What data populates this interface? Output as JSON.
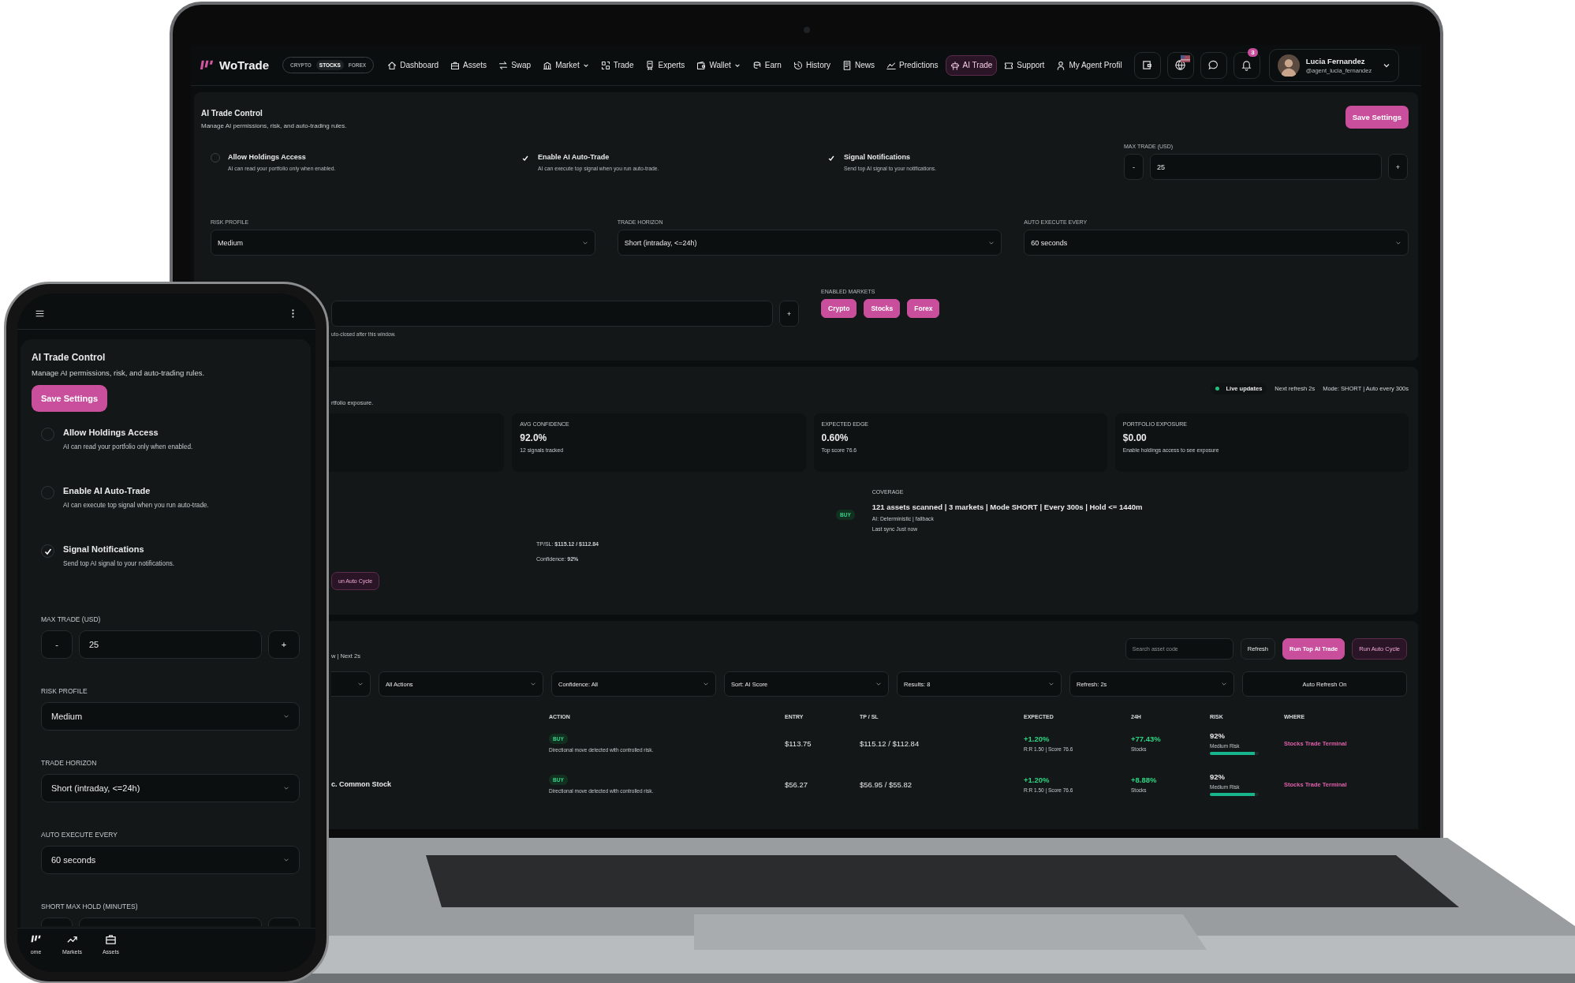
{
  "laptop": {
    "nav": {
      "brand": "WoTrade",
      "market_switch": [
        {
          "label": "CRYPTO",
          "selected": false
        },
        {
          "label": "STOCKS",
          "selected": true
        },
        {
          "label": "FOREX",
          "selected": false
        }
      ],
      "items": [
        {
          "label": "Dashboard",
          "dropdown": false,
          "selected": false
        },
        {
          "label": "Assets",
          "dropdown": false,
          "selected": false
        },
        {
          "label": "Swap",
          "dropdown": false,
          "selected": false
        },
        {
          "label": "Market",
          "dropdown": true,
          "selected": false
        },
        {
          "label": "Trade",
          "dropdown": false,
          "selected": false
        },
        {
          "label": "Experts",
          "dropdown": false,
          "selected": false
        },
        {
          "label": "Wallet",
          "dropdown": true,
          "selected": false
        },
        {
          "label": "Earn",
          "dropdown": false,
          "selected": false
        },
        {
          "label": "History",
          "dropdown": false,
          "selected": false
        },
        {
          "label": "News",
          "dropdown": false,
          "selected": false
        },
        {
          "label": "Predictions",
          "dropdown": false,
          "selected": false
        },
        {
          "label": "AI Trade",
          "dropdown": false,
          "selected": true
        },
        {
          "label": "Support",
          "dropdown": false,
          "selected": false
        },
        {
          "label": "My Agent Profil",
          "dropdown": false,
          "selected": false
        }
      ],
      "notification_count": "3",
      "user": {
        "name": "Lucia Fernandez",
        "handle": "@agent_lucia_fernandez"
      }
    },
    "settings": {
      "title": "AI Trade Control",
      "subtitle": "Manage AI permissions, risk, and auto-trading rules.",
      "save_button": "Save Settings",
      "toggles": [
        {
          "title": "Allow Holdings Access",
          "description": "AI can read your portfolio only when enabled.",
          "checked": false
        },
        {
          "title": "Enable AI Auto-Trade",
          "description": "AI can execute top signal when you run auto-trade.",
          "checked": true
        },
        {
          "title": "Signal Notifications",
          "description": "Send top AI signal to your notifications.",
          "checked": true
        }
      ],
      "max_trade": {
        "label": "MAX TRADE (USD)",
        "minus": "-",
        "value": "25",
        "plus": "+"
      },
      "selects": [
        {
          "label": "RISK PROFILE",
          "value": "Medium"
        },
        {
          "label": "TRADE HORIZON",
          "value": "Short (intraday, <=24h)"
        },
        {
          "label": "AUTO EXECUTE EVERY",
          "value": "60 seconds"
        }
      ],
      "hold_field": {
        "plus": "+",
        "hint": "uto-closed after this window."
      },
      "markets": {
        "label": "ENABLED MARKETS",
        "chips": [
          {
            "label": "Crypto",
            "selected": true
          },
          {
            "label": "Stocks",
            "selected": true
          },
          {
            "label": "Forex",
            "selected": true
          }
        ]
      }
    },
    "signals": {
      "subtitle": "rtfolio exposure.",
      "live": "Live updates",
      "next_refresh": "Next refresh 2s",
      "mode": "Mode: SHORT | Auto every 300s",
      "stats": [
        {
          "label": "AVG CONFIDENCE",
          "value": "92.0%",
          "note": "12 signals tracked"
        },
        {
          "label": "EXPECTED EDGE",
          "value": "0.60%",
          "note": "Top score 76.6"
        },
        {
          "label": "PORTFOLIO EXPOSURE",
          "value": "$0.00",
          "note": "Enable holdings access to see exposure"
        }
      ],
      "tp_sl": "TP/SL: **$115.12 / $112.84**",
      "confidence": "Confidence: **92%**",
      "run_button": "un Auto Cycle",
      "action": "BUY",
      "coverage": {
        "label": "COVERAGE",
        "summary": "121 assets scanned | 3 markets | Mode SHORT | Every 300s | Hold <= 1440m",
        "ai": "AI: Deterministic | fallback",
        "sync": "Last sync Just now"
      }
    },
    "screener": {
      "status": "w | Next 2s",
      "search_placeholder": "Search asset code",
      "buttons": [
        {
          "label": "Refresh",
          "kind": "plain"
        },
        {
          "label": "Run Top AI Trade",
          "kind": "primary"
        },
        {
          "label": "Run Auto Cycle",
          "kind": "outline"
        }
      ],
      "filters": [
        {
          "value": "All Actions",
          "kind": "select"
        },
        {
          "value": "Confidence: All",
          "kind": "select"
        },
        {
          "value": "Sort: AI Score",
          "kind": "select"
        },
        {
          "value": "Results: 8",
          "kind": "select"
        },
        {
          "value": "Refresh: 2s",
          "kind": "select"
        },
        {
          "value": "Auto Refresh On",
          "kind": "toggle"
        }
      ],
      "columns": [
        "ACTION",
        "ENTRY",
        "TP / SL",
        "EXPECTED",
        "24H",
        "RISK",
        "WHERE"
      ],
      "rows": [
        {
          "action": "BUY",
          "reason": "Directional move detected with controlled risk.",
          "entry": "$113.75",
          "tp_sl": "$115.12 / $112.84",
          "expected": "+1.20%",
          "expected_note": "R:R 1.50 | Score 76.6",
          "change": "+77.43%",
          "market": "Stocks",
          "risk": "92%",
          "risk_label": "Medium Risk",
          "level": 0.92,
          "where": "Stocks Trade Terminal"
        },
        {
          "asset": "c. Common Stock",
          "action": "BUY",
          "reason": "Directional move detected with controlled risk.",
          "entry": "$56.27",
          "tp_sl": "$56.95 / $55.82",
          "expected": "+1.20%",
          "expected_note": "R:R 1.50 | Score 76.6",
          "change": "+8.88%",
          "market": "Stocks",
          "risk": "92%",
          "risk_label": "Medium Risk",
          "level": 0.92,
          "where": "Stocks Trade Terminal"
        }
      ]
    }
  },
  "phone": {
    "title": "AI Trade Control",
    "subtitle": "Manage AI permissions, risk, and auto-trading rules.",
    "save_button": "Save Settings",
    "toggles": [
      {
        "title": "Allow Holdings Access",
        "description": "AI can read your portfolio only when enabled.",
        "checked": false
      },
      {
        "title": "Enable AI Auto-Trade",
        "description": "AI can execute top signal when you run auto-trade.",
        "checked": false
      },
      {
        "title": "Signal Notifications",
        "description": "Send top AI signal to your notifications.",
        "checked": true
      }
    ],
    "max_trade": {
      "label": "MAX TRADE (USD)",
      "minus": "-",
      "value": "25",
      "plus": "+"
    },
    "selects": [
      {
        "label": "RISK PROFILE",
        "value": "Medium"
      },
      {
        "label": "TRADE HORIZON",
        "value": "Short (intraday, <=24h)"
      },
      {
        "label": "AUTO EXECUTE EVERY",
        "value": "60 seconds"
      }
    ],
    "hold_label": "SHORT MAX HOLD (MINUTES)",
    "bottom_nav": [
      "ome",
      "Markets",
      "Assets"
    ]
  }
}
